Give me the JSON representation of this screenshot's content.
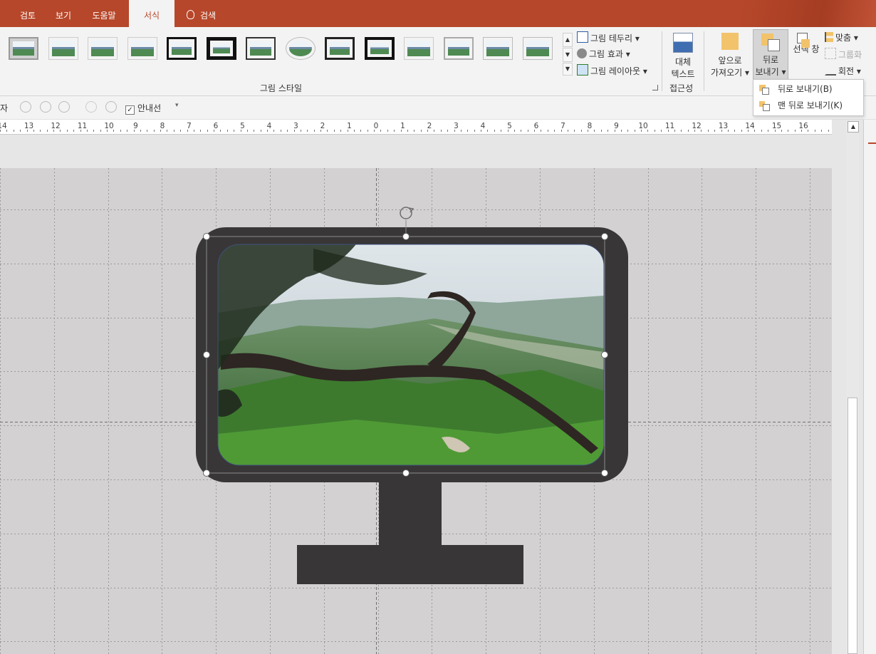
{
  "tabs": [
    {
      "label": "검토",
      "active": false
    },
    {
      "label": "보기",
      "active": false
    },
    {
      "label": "도움말",
      "active": false
    },
    {
      "label": "서식",
      "active": true
    }
  ],
  "tell_me": {
    "label": "검색",
    "icon": "lightbulb-icon"
  },
  "ribbon": {
    "picture_styles": {
      "group_label": "그림 스타일",
      "style_count": 14,
      "border_label": "그림 테두리",
      "effects_label": "그림 효과",
      "layout_label": "그림 레이아웃"
    },
    "accessibility": {
      "alt_text_label_line1": "대체",
      "alt_text_label_line2": "텍스트",
      "group_label": "접근성"
    },
    "arrange": {
      "bring_forward_line1": "앞으로",
      "bring_forward_line2": "가져오기",
      "send_backward_line1": "뒤로",
      "send_backward_line2": "보내기",
      "selection_pane_label": "선택 창",
      "align_label": "맞춤",
      "group_label_btn": "그룹화",
      "rotate_label": "회전"
    }
  },
  "dropdown": {
    "items": [
      {
        "label": "뒤로 보내기(B)",
        "icon": "send-backward-icon"
      },
      {
        "label": "맨 뒤로 보내기(K)",
        "icon": "send-to-back-icon"
      }
    ]
  },
  "qabar": {
    "partial_label": "자",
    "guides_label": "안내선",
    "guides_checked": true
  },
  "ruler": {
    "labels": [
      "14",
      "13",
      "12",
      "11",
      "10",
      "9",
      "8",
      "7",
      "6",
      "5",
      "4",
      "3",
      "2",
      "1",
      "0",
      "1",
      "2",
      "3",
      "4",
      "5",
      "6",
      "7",
      "8",
      "9",
      "10",
      "11",
      "12",
      "13",
      "14",
      "15",
      "16"
    ]
  },
  "colors": {
    "accent": "#b7472a",
    "monitor": "#383636",
    "slide_bg": "#d3d1d2"
  }
}
